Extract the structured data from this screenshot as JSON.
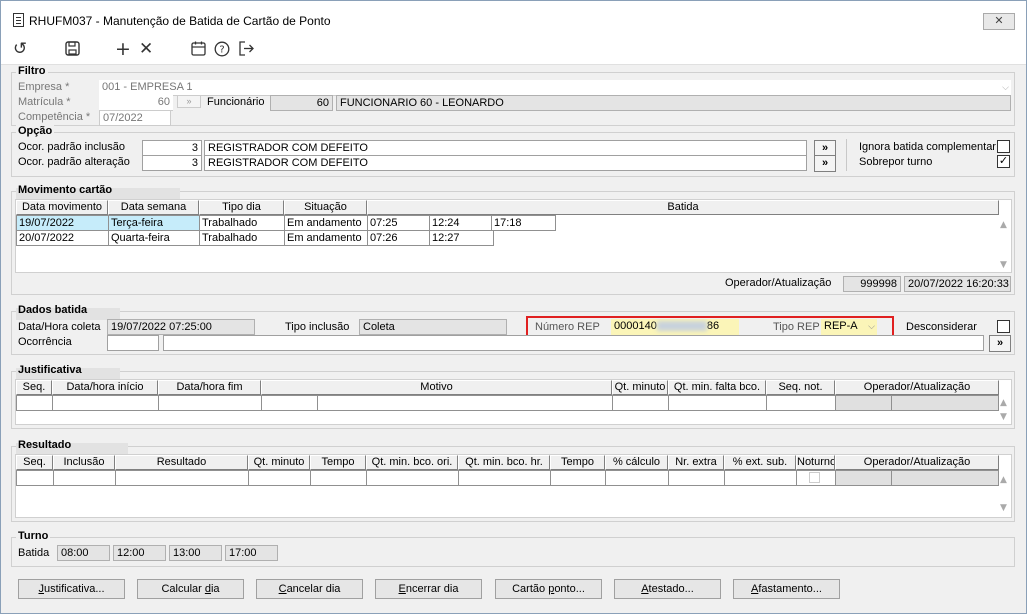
{
  "window": {
    "title": "RHUFM037 - Manutenção de Batida de Cartão de Ponto",
    "close_glyph": "✕"
  },
  "toolbar": {
    "icons": [
      "refresh-icon",
      "save-icon",
      "add-icon",
      "delete-icon",
      "calendar-icon",
      "help-icon",
      "exit-icon"
    ]
  },
  "filtro": {
    "title": "Filtro",
    "empresa_label": "Empresa *",
    "empresa_value": "001 - EMPRESA 1",
    "matricula_label": "Matrícula *",
    "matricula_value": "60",
    "funcionario_label": "Funcionário",
    "funcionario_code": "60",
    "funcionario_name": "FUNCIONARIO 60 - LEONARDO",
    "competencia_label": "Competência *",
    "competencia_value": "07/2022"
  },
  "opcao": {
    "title": "Opção",
    "inclusao_label": "Ocor. padrão inclusão",
    "inclusao_code": "3",
    "inclusao_desc": "REGISTRADOR COM DEFEITO",
    "alteracao_label": "Ocor. padrão alteração",
    "alteracao_code": "3",
    "alteracao_desc": "REGISTRADOR COM DEFEITO",
    "ignora_label": "Ignora batida complementar",
    "ignora_checked": false,
    "sobrepor_label": "Sobrepor turno",
    "sobrepor_checked": true,
    "more_glyph": "»"
  },
  "movimento": {
    "title": "Movimento cartão",
    "headers": [
      "Data movimento",
      "Data semana",
      "Tipo dia",
      "Situação",
      "Batida"
    ],
    "rows": [
      {
        "data": "19/07/2022",
        "semana": "Terça-feira",
        "tipo": "Trabalhado",
        "situacao": "Em andamento",
        "batidas": [
          "07:25",
          "12:24",
          "17:18"
        ]
      },
      {
        "data": "20/07/2022",
        "semana": "Quarta-feira",
        "tipo": "Trabalhado",
        "situacao": "Em andamento",
        "batidas": [
          "07:26",
          "12:27"
        ]
      }
    ],
    "operador_label": "Operador/Atualização",
    "operador_code": "999998",
    "operador_datetime": "20/07/2022 16:20:33"
  },
  "dados": {
    "title": "Dados batida",
    "datahora_label": "Data/Hora coleta",
    "datahora_value": "19/07/2022 07:25:00",
    "tipo_inclusao_label": "Tipo inclusão",
    "tipo_inclusao_value": "Coleta",
    "numero_rep_label": "Número REP",
    "numero_rep_prefix": "0000140",
    "numero_rep_suffix": "86",
    "tipo_rep_label": "Tipo REP",
    "tipo_rep_value": "REP-A",
    "desconsiderar_label": "Desconsiderar",
    "desconsiderar_checked": false,
    "ocorrencia_label": "Ocorrência"
  },
  "justificativa": {
    "title": "Justificativa",
    "headers": [
      "Seq.",
      "Data/hora início",
      "Data/hora fim",
      "Motivo",
      "Qt. minuto",
      "Qt. min. falta bco.",
      "Seq. not.",
      "Operador/Atualização"
    ]
  },
  "resultado": {
    "title": "Resultado",
    "headers": [
      "Seq.",
      "Inclusão",
      "Resultado",
      "Qt. minuto",
      "Tempo",
      "Qt. min. bco. ori.",
      "Qt. min. bco. hr.",
      "Tempo",
      "% cálculo",
      "Nr. extra",
      "% ext. sub.",
      "Noturno",
      "Operador/Atualização"
    ]
  },
  "turno": {
    "title": "Turno",
    "batida_label": "Batida",
    "times": [
      "08:00",
      "12:00",
      "13:00",
      "17:00"
    ]
  },
  "footer_buttons": [
    {
      "pre": "",
      "u": "J",
      "post": "ustificativa..."
    },
    {
      "pre": "Calcular ",
      "u": "d",
      "post": "ia"
    },
    {
      "pre": "",
      "u": "C",
      "post": "ancelar dia"
    },
    {
      "pre": "",
      "u": "E",
      "post": "ncerrar dia"
    },
    {
      "pre": "Cartão ",
      "u": "p",
      "post": "onto..."
    },
    {
      "pre": "",
      "u": "A",
      "post": "testado..."
    },
    {
      "pre": "",
      "u": "A",
      "post": "fastamento..."
    }
  ]
}
